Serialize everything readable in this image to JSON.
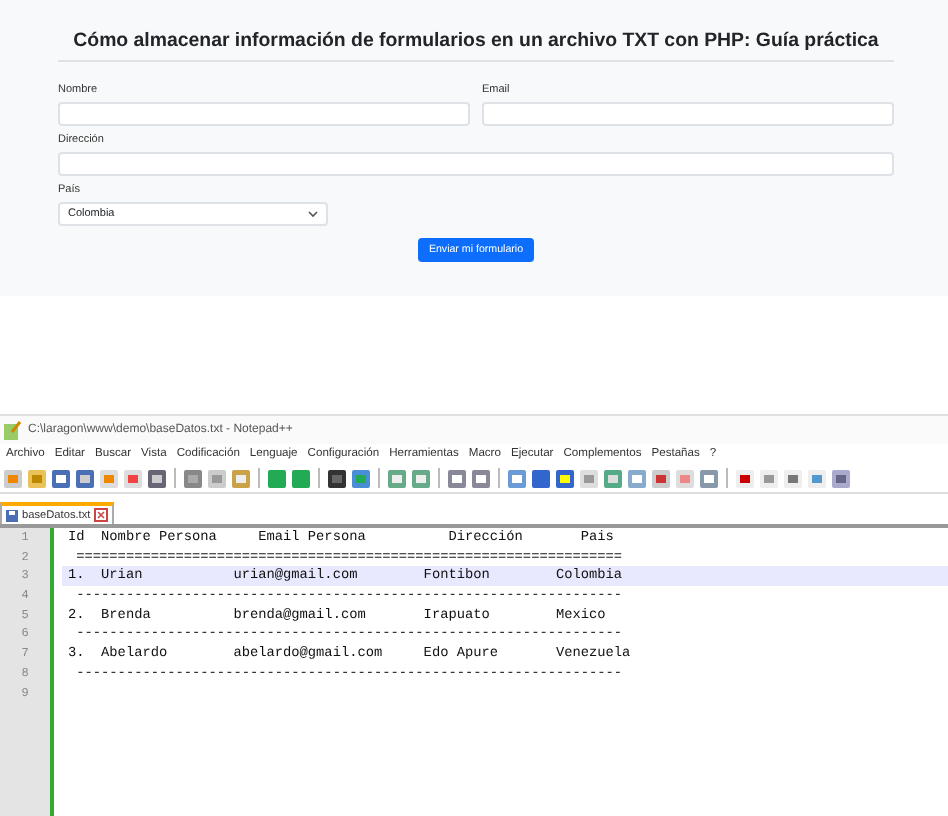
{
  "page": {
    "title": "Cómo almacenar información de formularios en un archivo TXT con PHP: Guía práctica",
    "fields": [
      {
        "kind": "text",
        "label": "Nombre"
      },
      {
        "kind": "text",
        "label": "Email"
      },
      {
        "kind": "text",
        "label": "Dirección"
      },
      {
        "kind": "select",
        "label": "País",
        "value": "Colombia"
      }
    ],
    "submit": "Enviar mi formulario"
  },
  "editor": {
    "window_title": "C:\\laragon\\www\\demo\\baseDatos.txt - Notepad++",
    "menu": [
      "Archivo",
      "Editar",
      "Buscar",
      "Vista",
      "Codificación",
      "Lenguaje",
      "Configuración",
      "Herramientas",
      "Macro",
      "Ejecutar",
      "Complementos",
      "Pestañas",
      "?"
    ],
    "tabs": [
      {
        "label": "baseDatos.txt",
        "selected": true
      }
    ],
    "lines": [
      {
        "number": "1",
        "text": "Id  Nombre Persona     Email Persona          Dirección       Pais",
        "current": false
      },
      {
        "number": "2",
        "text": " ==================================================================",
        "current": false
      },
      {
        "number": "3",
        "text": "1.  Urian           urian@gmail.com        Fontibon        Colombia",
        "current": true
      },
      {
        "number": "4",
        "text": " ------------------------------------------------------------------",
        "current": false
      },
      {
        "number": "5",
        "text": "2.  Brenda          brenda@gmail.com       Irapuato        Mexico",
        "current": false
      },
      {
        "number": "6",
        "text": " ------------------------------------------------------------------",
        "current": false
      },
      {
        "number": "7",
        "text": "3.  Abelardo        abelardo@gmail.com     Edo Apure       Venezuela",
        "current": false
      },
      {
        "number": "8",
        "text": " ------------------------------------------------------------------",
        "current": false
      },
      {
        "number": "9",
        "current": false
      }
    ]
  }
}
